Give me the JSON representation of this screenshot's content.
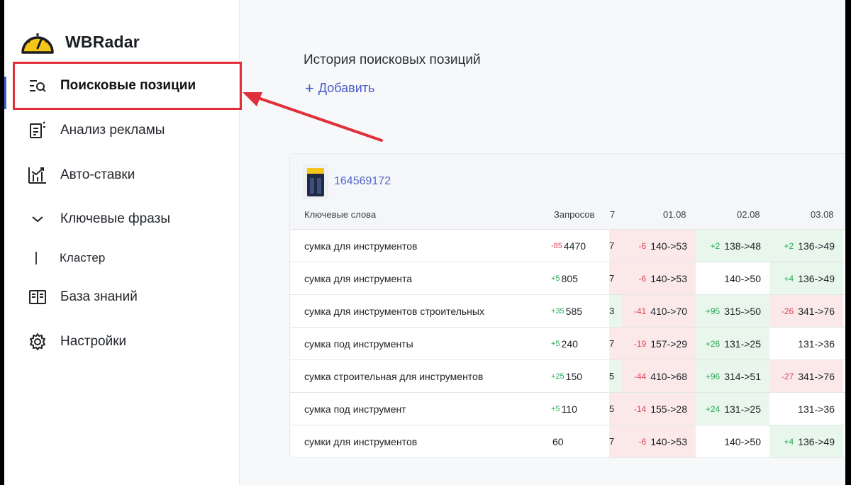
{
  "app": {
    "name": "WBRadar",
    "colors": {
      "accent": "#4b5fd1",
      "highlight": "#e0303b",
      "negative": "#e04454",
      "positive": "#2aa857",
      "logo": "#f5c518"
    }
  },
  "sidebar": {
    "items": [
      {
        "label": "Поисковые позиции",
        "icon": "search-list-icon",
        "active": true
      },
      {
        "label": "Анализ рекламы",
        "icon": "ad-report-icon"
      },
      {
        "label": "Авто-ставки",
        "icon": "bar-chart-arrow-icon"
      },
      {
        "label": "Ключевые фразы",
        "icon": "chevron-down-icon"
      },
      {
        "label": "Кластер",
        "icon": ""
      },
      {
        "label": "База знаний",
        "icon": "book-icon"
      },
      {
        "label": "Настройки",
        "icon": "gear-icon"
      }
    ]
  },
  "main": {
    "title": "История поисковых позиций",
    "add_label": "Добавить",
    "product": {
      "sku": "164569172"
    },
    "table": {
      "headers": {
        "keyword": "Ключевые слова",
        "requests": "Запросов",
        "edge": "7",
        "dates": [
          "01.08",
          "02.08",
          "03.08"
        ]
      },
      "rows": [
        {
          "keyword": "сумка для инструментов",
          "req_delta": "-85",
          "req_sign": "neg",
          "requests": "4470",
          "edge": "7",
          "positions": [
            {
              "delta": "-6",
              "value": "140->53",
              "tone": "neg"
            },
            {
              "delta": "+2",
              "value": "138->48",
              "tone": "pos"
            },
            {
              "delta": "+2",
              "value": "136->49",
              "tone": "pos"
            }
          ]
        },
        {
          "keyword": "сумка для инструмента",
          "req_delta": "+5",
          "req_sign": "pos",
          "requests": "805",
          "edge": "7",
          "positions": [
            {
              "delta": "-6",
              "value": "140->53",
              "tone": "neg"
            },
            {
              "delta": "",
              "value": "140->50",
              "tone": "neu"
            },
            {
              "delta": "+4",
              "value": "136->49",
              "tone": "pos"
            }
          ]
        },
        {
          "keyword": "сумка для инструментов строительных",
          "req_delta": "+35",
          "req_sign": "pos",
          "requests": "585",
          "edge": "3",
          "positions": [
            {
              "delta": "-41",
              "value": "410->70",
              "tone": "neg"
            },
            {
              "delta": "+95",
              "value": "315->50",
              "tone": "pos"
            },
            {
              "delta": "-26",
              "value": "341->76",
              "tone": "neg"
            }
          ]
        },
        {
          "keyword": "сумка под инструменты",
          "req_delta": "+5",
          "req_sign": "pos",
          "requests": "240",
          "edge": "7",
          "positions": [
            {
              "delta": "-19",
              "value": "157->29",
              "tone": "neg"
            },
            {
              "delta": "+26",
              "value": "131->25",
              "tone": "pos"
            },
            {
              "delta": "",
              "value": "131->36",
              "tone": "neu"
            }
          ]
        },
        {
          "keyword": "сумка строительная для инструментов",
          "req_delta": "+25",
          "req_sign": "pos",
          "requests": "150",
          "edge": "5",
          "positions": [
            {
              "delta": "-44",
              "value": "410->68",
              "tone": "neg"
            },
            {
              "delta": "+96",
              "value": "314->51",
              "tone": "pos"
            },
            {
              "delta": "-27",
              "value": "341->76",
              "tone": "neg"
            }
          ]
        },
        {
          "keyword": "сумка под инструмент",
          "req_delta": "+5",
          "req_sign": "pos",
          "requests": "110",
          "edge": "5",
          "positions": [
            {
              "delta": "-14",
              "value": "155->28",
              "tone": "neg"
            },
            {
              "delta": "+24",
              "value": "131->25",
              "tone": "pos"
            },
            {
              "delta": "",
              "value": "131->36",
              "tone": "neu"
            }
          ]
        },
        {
          "keyword": "сумки для инструментов",
          "req_delta": "",
          "req_sign": "neu",
          "requests": "60",
          "edge": "7",
          "positions": [
            {
              "delta": "-6",
              "value": "140->53",
              "tone": "neg"
            },
            {
              "delta": "",
              "value": "140->50",
              "tone": "neu"
            },
            {
              "delta": "+4",
              "value": "136->49",
              "tone": "pos"
            }
          ]
        }
      ]
    }
  }
}
